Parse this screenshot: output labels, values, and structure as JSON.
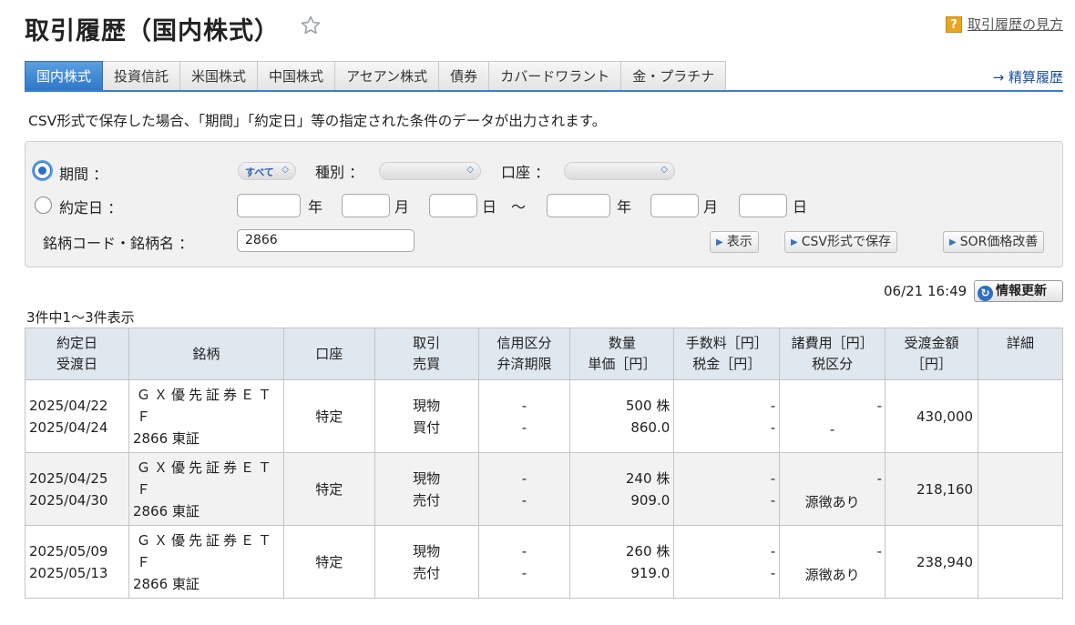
{
  "header": {
    "title": "取引履歴（国内株式）",
    "help_label": "取引履歴の見方",
    "help_icon": "?"
  },
  "tabs": [
    {
      "label": "国内株式",
      "active": true
    },
    {
      "label": "投資信託",
      "active": false
    },
    {
      "label": "米国株式",
      "active": false
    },
    {
      "label": "中国株式",
      "active": false
    },
    {
      "label": "アセアン株式",
      "active": false
    },
    {
      "label": "債券",
      "active": false
    },
    {
      "label": "カバードワラント",
      "active": false
    },
    {
      "label": "金・プラチナ",
      "active": false
    }
  ],
  "settlement_link": "→ 精算履歴",
  "csv_note": "CSV形式で保存した場合、「期間」「約定日」等の指定された条件のデータが出力されます。",
  "filter": {
    "period_label": "期間 ：",
    "period_value": "すべて",
    "type_label": "種別 ：",
    "account_label": "口座 ：",
    "trade_date_label": "約定日 ：",
    "year_label": "年",
    "month_label": "月",
    "day_label": "日",
    "tilde": "～",
    "stock_label": "銘柄コード・銘柄名 ：",
    "stock_value": "2866",
    "show_button": "表示",
    "csv_button": "CSV形式で保存",
    "sor_button": "SOR価格改善",
    "select_arrow": "◇"
  },
  "timestamp": "06/21 16:49",
  "refresh_button": "情報更新",
  "count_text": "3件中1～3件表示",
  "table": {
    "headers": {
      "date_1": "約定日",
      "date_2": "受渡日",
      "name": "銘柄",
      "account": "口座",
      "trade_1": "取引",
      "trade_2": "売買",
      "credit_1": "信用区分",
      "credit_2": "弁済期限",
      "qty_1": "数量",
      "qty_2": "単価［円］",
      "fee_1": "手数料［円］",
      "fee_2": "税金［円］",
      "misc_1": "諸費用［円］",
      "misc_2": "税区分",
      "amount_1": "受渡金額",
      "amount_2": "［円］",
      "detail": "詳細"
    },
    "rows": [
      {
        "trade_date": "2025/04/22",
        "settle_date": "2025/04/24",
        "name_1": "ＧＸ優先証券ＥＴ",
        "name_2": "Ｆ",
        "name_3": "2866 東証",
        "account": "特定",
        "trade_type": "現物",
        "side": "買付",
        "credit_type": "-",
        "due": "-",
        "qty": "500 株",
        "price": "860.0",
        "fee": "-",
        "tax": "-",
        "misc": "-",
        "tax_class": "-",
        "amount": "430,000",
        "detail": ""
      },
      {
        "trade_date": "2025/04/25",
        "settle_date": "2025/04/30",
        "name_1": "ＧＸ優先証券ＥＴ",
        "name_2": "Ｆ",
        "name_3": "2866 東証",
        "account": "特定",
        "trade_type": "現物",
        "side": "売付",
        "credit_type": "-",
        "due": "-",
        "qty": "240 株",
        "price": "909.0",
        "fee": "-",
        "tax": "-",
        "misc": "-",
        "tax_class": "源徴あり",
        "amount": "218,160",
        "detail": ""
      },
      {
        "trade_date": "2025/05/09",
        "settle_date": "2025/05/13",
        "name_1": "ＧＸ優先証券ＥＴ",
        "name_2": "Ｆ",
        "name_3": "2866 東証",
        "account": "特定",
        "trade_type": "現物",
        "side": "売付",
        "credit_type": "-",
        "due": "-",
        "qty": "260 株",
        "price": "919.0",
        "fee": "-",
        "tax": "-",
        "misc": "-",
        "tax_class": "源徴あり",
        "amount": "238,940",
        "detail": ""
      }
    ]
  }
}
